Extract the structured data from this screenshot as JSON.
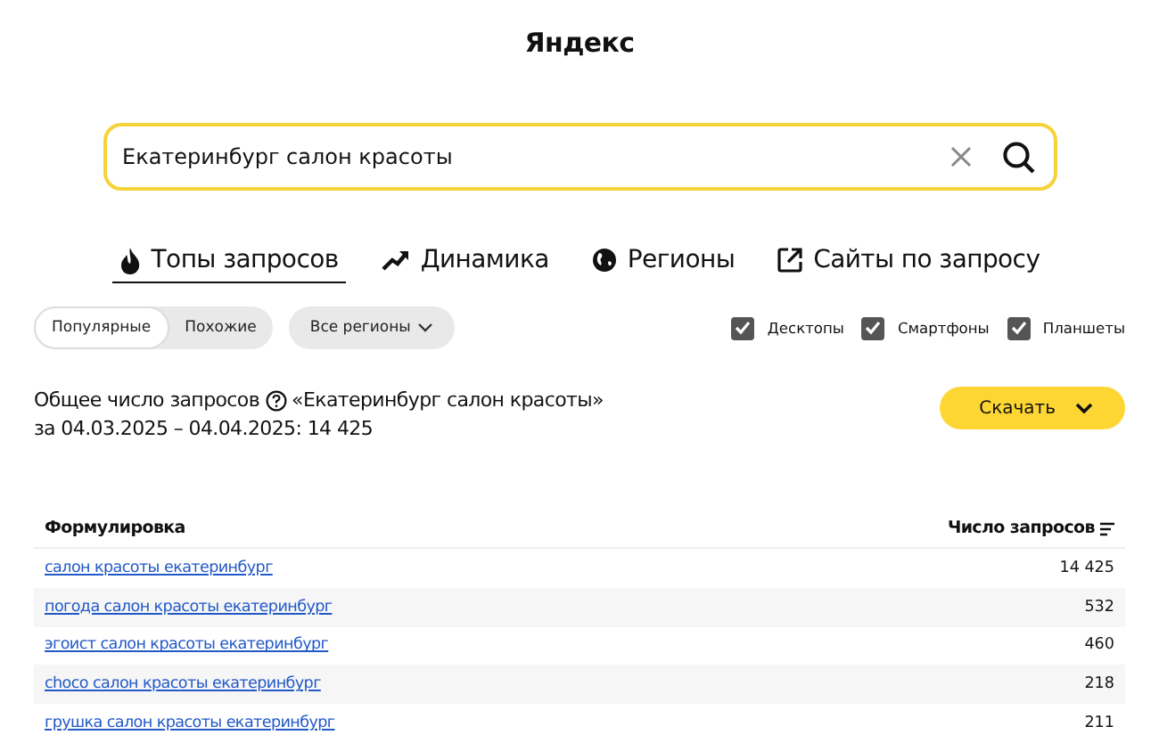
{
  "logo": "Яндекс",
  "search": {
    "value": "Екатеринбург салон красоты"
  },
  "tabs": [
    {
      "label": "Топы запросов",
      "kind": "top",
      "selected": true
    },
    {
      "label": "Динамика",
      "kind": "dynamics",
      "selected": false
    },
    {
      "label": "Регионы",
      "kind": "regions",
      "selected": false
    },
    {
      "label": "Сайты по запросу",
      "kind": "sites",
      "selected": false
    }
  ],
  "mode": [
    {
      "label": "Популярные",
      "selected": true
    },
    {
      "label": "Похожие",
      "selected": false
    }
  ],
  "region": "Все регионы",
  "devices": [
    {
      "label": "Десктопы",
      "checked": true
    },
    {
      "label": "Смартфоны",
      "checked": true
    },
    {
      "label": "Планшеты",
      "checked": true
    }
  ],
  "summary": {
    "title": "Общее число запросов",
    "query": "«Екатеринбург салон красоты»",
    "period": "за 04.03.2025 – 04.04.2025: 14 425"
  },
  "download": "Скачать",
  "table": {
    "columns": [
      "Формулировка",
      "Число запросов"
    ],
    "rows": [
      {
        "phrase": "салон красоты екатеринбург",
        "count": "14 425"
      },
      {
        "phrase": "погода салон красоты екатеринбург",
        "count": "532"
      },
      {
        "phrase": "эгоист салон красоты екатеринбург",
        "count": "460"
      },
      {
        "phrase": "choco салон красоты екатеринбург",
        "count": "218"
      },
      {
        "phrase": "грушка салон красоты екатеринбург",
        "count": "211"
      }
    ]
  }
}
